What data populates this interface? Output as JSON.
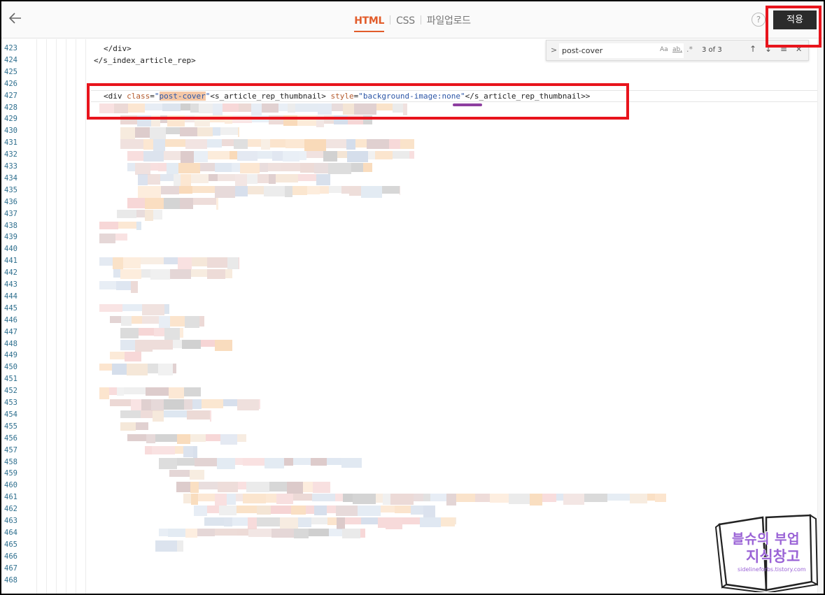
{
  "header": {
    "tabs": [
      {
        "label": "HTML"
      },
      {
        "label": "CSS"
      },
      {
        "label": "파일업로드"
      }
    ],
    "help_icon_text": "?",
    "apply_label": "적용"
  },
  "find": {
    "query": "post-cover",
    "toggle_symbol": ">",
    "opt_case": "Aa",
    "opt_word": "ab,",
    "opt_regex": ".*",
    "count": "3 of 3",
    "prev_symbol": "↑",
    "next_symbol": "↓",
    "selection_symbol": "≡",
    "close_symbol": "✕"
  },
  "editor": {
    "line_numbers": [
      "423",
      "424",
      "425",
      "426",
      "427",
      "428",
      "429",
      "430",
      "431",
      "432",
      "433",
      "434",
      "435",
      "436",
      "437",
      "438",
      "439",
      "440",
      "441",
      "442",
      "443",
      "444",
      "445",
      "446",
      "447",
      "448",
      "449",
      "450",
      "451",
      "452",
      "453",
      "454",
      "455",
      "456",
      "457",
      "458",
      "459",
      "460",
      "461",
      "462",
      "463",
      "464",
      "465",
      "466",
      "467",
      "468"
    ],
    "code": {
      "line_div_close": "</div>",
      "line_index_close": "</s_index_article_rep>",
      "l427_open": "<div ",
      "l427_attr": "class",
      "l427_eq": "=",
      "l427_q1": "\"",
      "l427_hit": "post-cover",
      "l427_q2": "\"",
      "l427_tag": "<s_article_rep_thumbnail> ",
      "l427_attr2": "style",
      "l427_eq2": "=",
      "l427_str2": "\"background-image:none\"",
      "l427_close": "</s_article_rep_thumbnail>>"
    }
  },
  "watermark": {
    "title": "블슈의 부업",
    "subtitle": "지식창고",
    "url": "sidelineforbs.tistory.com"
  },
  "colors": {
    "accent": "#e25c2a",
    "highlight_box": "#e8141c",
    "underline": "#8e3fa0",
    "apply_bg": "#2b2b2b"
  }
}
